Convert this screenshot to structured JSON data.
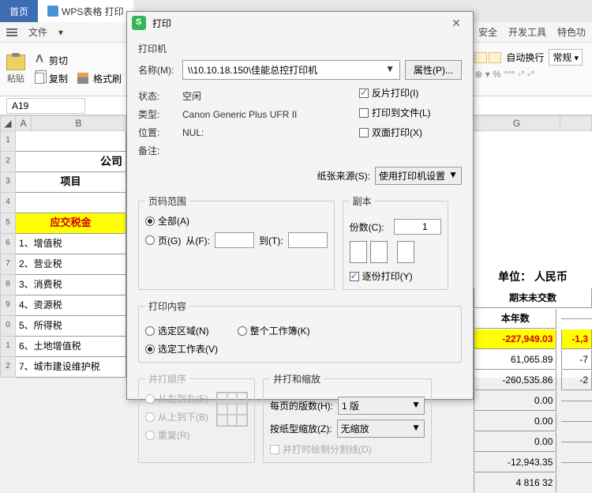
{
  "tabs": {
    "home": "首页",
    "file": "WPS表格 打印"
  },
  "menubar": {
    "file": "文件",
    "right1": "安全",
    "right2": "开发工具",
    "right3": "特色功"
  },
  "ribbon": {
    "paste": "粘贴",
    "cut": "剪切",
    "copy": "复制",
    "brush": "格式刷",
    "normal": "常规",
    "wrap": "自动换行"
  },
  "cellref": "A19",
  "colhdrs": [
    "A",
    "B",
    "G"
  ],
  "rowdata": {
    "title": "公司",
    "hdr": "项目",
    "tax": "应交税金",
    "rows": [
      "1、增值税",
      "2、营业税",
      "3、消费税",
      "4、资源税",
      "5、所得税",
      "6、土地增值税",
      "7、城市建设维护税"
    ]
  },
  "right": {
    "title": "单位：  人民币",
    "sub": "期末未交数",
    "hdr": "本年数",
    "rows": [
      [
        "-227,949.03",
        "-1,3"
      ],
      [
        "61,065.89",
        "-7"
      ],
      [
        "-260,535.86",
        "-2"
      ],
      [
        "0.00",
        ""
      ],
      [
        "0.00",
        ""
      ],
      [
        "0.00",
        ""
      ],
      [
        "-12,943.35",
        ""
      ],
      [
        "4 816 32",
        ""
      ]
    ]
  },
  "dlg": {
    "title": "打印",
    "printer_section": "打印机",
    "name_lbl": "名称(M):",
    "name_val": "\\\\10.10.18.150\\佳能总控打印机",
    "props_btn": "属性(P)...",
    "status_lbl": "状态:",
    "status_val": "空闲",
    "type_lbl": "类型:",
    "type_val": "Canon Generic Plus UFR II",
    "loc_lbl": "位置:",
    "loc_val": "NUL:",
    "note_lbl": "备注:",
    "reverse": "反片打印(I)",
    "tofile": "打印到文件(L)",
    "duplex": "双面打印(X)",
    "paper_lbl": "纸张来源(S):",
    "paper_val": "使用打印机设置",
    "range_legend": "页码范围",
    "all": "全部(A)",
    "page": "页(G)",
    "from": "从(F):",
    "to": "到(T):",
    "copies_legend": "副本",
    "copies_lbl": "份数(C):",
    "copies_val": "1",
    "collate": "逐份打印(Y)",
    "content_legend": "打印内容",
    "sel_area": "选定区域(N)",
    "workbook": "整个工作簿(K)",
    "worksheet": "选定工作表(V)",
    "order_legend": "并打顺序",
    "lr": "从左到右(E)",
    "tb": "从上到下(B)",
    "repeat": "重复(R)",
    "scale_legend": "并打和缩放",
    "perpage_lbl": "每页的版数(H):",
    "perpage_val": "1 版",
    "scale_lbl": "按纸型缩放(Z):",
    "scale_val": "无缩放",
    "cutline": "并打时绘制分割线(D)"
  }
}
